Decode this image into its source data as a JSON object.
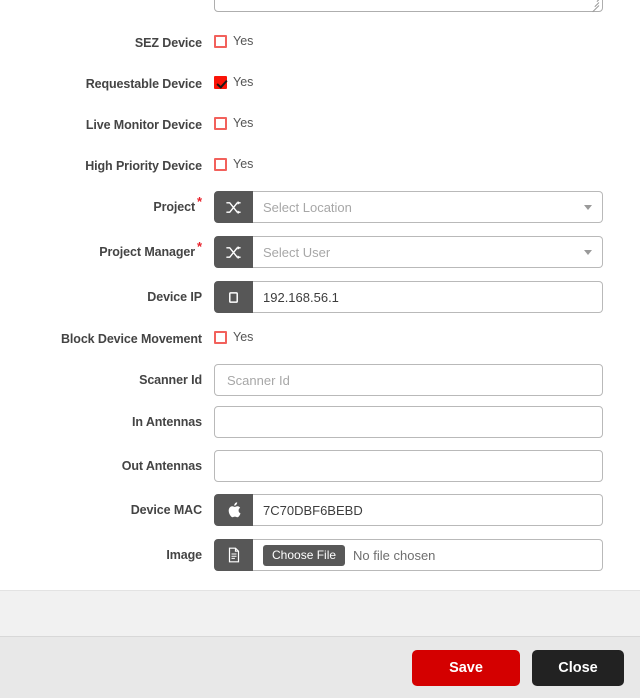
{
  "form": {
    "textarea": {
      "value": "",
      "resize_handle": "resize-grip"
    },
    "checkbox_rows": [
      {
        "label": "SEZ Device",
        "option": "Yes",
        "checked": false
      },
      {
        "label": "Requestable Device",
        "option": "Yes",
        "checked": true
      },
      {
        "label": "Live Monitor Device",
        "option": "Yes",
        "checked": false
      },
      {
        "label": "High Priority Device",
        "option": "Yes",
        "checked": false
      }
    ],
    "block_movement": {
      "label": "Block Device Movement",
      "option": "Yes",
      "checked": false
    },
    "project": {
      "label": "Project",
      "required": true,
      "required_marker": "*",
      "icon": "shuffle-icon",
      "value": "",
      "placeholder": "Select Location"
    },
    "project_manager": {
      "label": "Project Manager",
      "required": true,
      "required_marker": "*",
      "icon": "shuffle-icon",
      "value": "",
      "placeholder": "Select User"
    },
    "device_ip": {
      "label": "Device IP",
      "icon": "monitor-icon",
      "value": "192.168.56.1"
    },
    "scanner_id": {
      "label": "Scanner Id",
      "value": "",
      "placeholder": "Scanner Id"
    },
    "in_antennas": {
      "label": "In Antennas",
      "value": "",
      "placeholder": ""
    },
    "out_antennas": {
      "label": "Out Antennas",
      "value": "",
      "placeholder": ""
    },
    "device_mac": {
      "label": "Device MAC",
      "icon": "apple-icon",
      "value": "7C70DBF6BEBD"
    },
    "image": {
      "label": "Image",
      "icon": "document-icon",
      "choose_button": "Choose File",
      "file_status": "No file chosen"
    }
  },
  "footer": {
    "save_label": "Save",
    "close_label": "Close"
  },
  "colors": {
    "accent_red": "#d40000",
    "checkbox_border": "#f2615c",
    "checkbox_checked": "#fa1408",
    "required_star": "#e8202a",
    "prefix_bg": "#575757",
    "close_bg": "#222222",
    "footer_bg": "#e8e8e8"
  }
}
